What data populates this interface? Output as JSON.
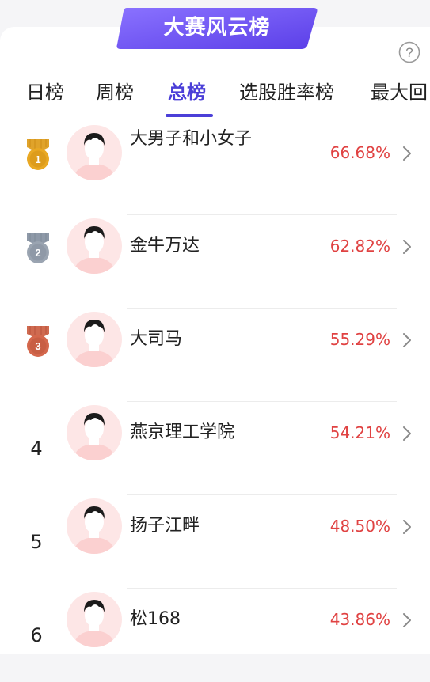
{
  "banner": {
    "title": "大赛风云榜"
  },
  "help": {
    "icon": "question-circle-icon",
    "glyph": "?"
  },
  "tabs": [
    {
      "label": "日榜",
      "active": false
    },
    {
      "label": "周榜",
      "active": false
    },
    {
      "label": "总榜",
      "active": true
    },
    {
      "label": "选股胜率榜",
      "active": false
    },
    {
      "label": "最大回",
      "active": false
    }
  ],
  "colors": {
    "accent": "#4b3fd8",
    "banner_gradient": [
      "#8a72ff",
      "#5b3fe8"
    ],
    "percent": "#e04242",
    "gold": "#e7a51f",
    "silver": "#8e99a8",
    "bronze": "#d0654a"
  },
  "leaderboard": [
    {
      "rank": "1",
      "medal": "gold",
      "medal_number": "1",
      "name": "大男子和小女子",
      "percent": "66.68%"
    },
    {
      "rank": "2",
      "medal": "silver",
      "medal_number": "2",
      "name": "金牛万达",
      "percent": "62.82%"
    },
    {
      "rank": "3",
      "medal": "bronze",
      "medal_number": "3",
      "name": "大司马",
      "percent": "55.29%"
    },
    {
      "rank": "4",
      "medal": null,
      "name": "燕京理工学院",
      "percent": "54.21%"
    },
    {
      "rank": "5",
      "medal": null,
      "name": "扬子江畔",
      "percent": "48.50%"
    },
    {
      "rank": "6",
      "medal": null,
      "name": "松168",
      "percent": "43.86%"
    }
  ]
}
